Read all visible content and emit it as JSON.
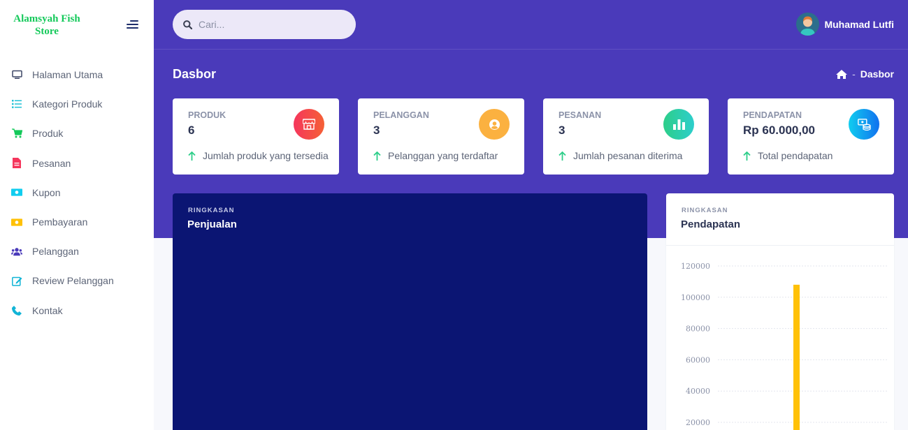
{
  "brand": {
    "line1": "Alamsyah Fish",
    "line2": "Store"
  },
  "sidebar": {
    "items": [
      {
        "label": "Halaman Utama",
        "icon": "monitor-icon",
        "color": "#3d4666"
      },
      {
        "label": "Kategori Produk",
        "icon": "list-icon",
        "color": "#22c1d6"
      },
      {
        "label": "Produk",
        "icon": "cart-icon",
        "color": "#14c95a"
      },
      {
        "label": "Pesanan",
        "icon": "document-icon",
        "color": "#f5365c"
      },
      {
        "label": "Kupon",
        "icon": "ticket-icon",
        "color": "#11cdef"
      },
      {
        "label": "Pembayaran",
        "icon": "money-icon",
        "color": "#ffc107"
      },
      {
        "label": "Pelanggan",
        "icon": "users-icon",
        "color": "#4a3aba"
      },
      {
        "label": "Review Pelanggan",
        "icon": "edit-icon",
        "color": "#11b4d6"
      },
      {
        "label": "Kontak",
        "icon": "phone-icon",
        "color": "#11b4d6"
      }
    ]
  },
  "search": {
    "placeholder": "Cari..."
  },
  "user": {
    "name": "Muhamad Lutfi"
  },
  "page": {
    "title": "Dasbor"
  },
  "breadcrumb": {
    "home_icon": "home-icon",
    "separator": "-",
    "current": "Dasbor"
  },
  "stats": [
    {
      "label": "PRODUK",
      "value": "6",
      "note": "Jumlah produk yang tersedia",
      "icon": "store-icon",
      "color": "#f5365c"
    },
    {
      "label": "PELANGGAN",
      "value": "3",
      "note": "Pelanggan yang terdaftar",
      "icon": "user-circle-icon",
      "color": "#fbb140"
    },
    {
      "label": "PESANAN",
      "value": "3",
      "note": "Jumlah pesanan diterima",
      "icon": "bar-chart-icon",
      "color": "#2dce89"
    },
    {
      "label": "PENDAPATAN",
      "value": "Rp 60.000,00",
      "note": "Total pendapatan",
      "icon": "money-stack-icon",
      "color": "#1171ef"
    }
  ],
  "sales_panel": {
    "overline": "RINGKASAN",
    "title": "Penjualan"
  },
  "revenue_panel": {
    "overline": "RINGKASAN",
    "title": "Pendapatan"
  },
  "chart_data": {
    "type": "bar",
    "title": "",
    "xlabel": "",
    "ylabel": "",
    "ylim": [
      0,
      120000
    ],
    "yticks": [
      20000,
      40000,
      60000,
      80000,
      100000,
      120000
    ],
    "categories": [
      ""
    ],
    "values": [
      108000
    ],
    "bar_color": "#ffc107",
    "grid": true
  }
}
